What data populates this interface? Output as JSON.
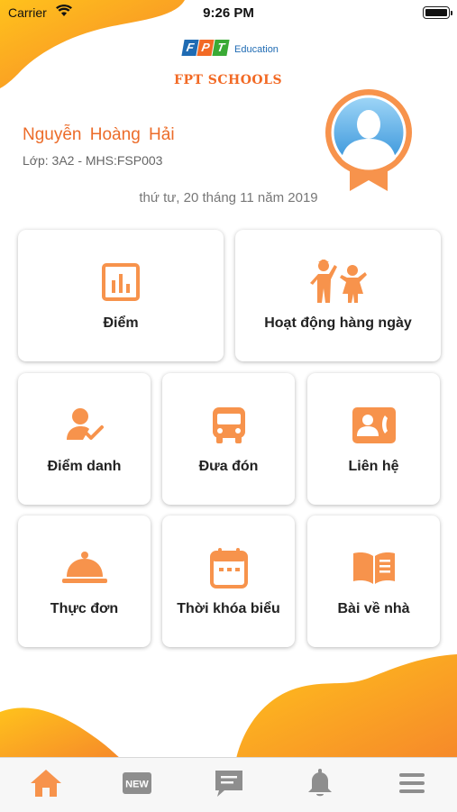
{
  "status_bar": {
    "carrier": "Carrier",
    "time": "9:26 PM"
  },
  "logo": {
    "letters": [
      "F",
      "P",
      "T"
    ],
    "letter_colors": [
      "#1f6bb3",
      "#f26a25",
      "#3aaa35"
    ],
    "education": "Education",
    "schools": "FPT SCHOOLS"
  },
  "student": {
    "name": "Nguyễn Hoàng Hải",
    "class_info": "Lớp: 3A2 - MHS:FSP003"
  },
  "date": "thứ tư, 20 tháng 11 năm 2019",
  "menu": [
    {
      "label": "Điểm",
      "icon": "chart-icon"
    },
    {
      "label": "Hoạt động hàng ngày",
      "icon": "kids-activity-icon"
    },
    {
      "label": "Điểm danh",
      "icon": "attendance-icon"
    },
    {
      "label": "Đưa đón",
      "icon": "bus-icon"
    },
    {
      "label": "Liên hệ",
      "icon": "contact-icon"
    },
    {
      "label": "Thực đơn",
      "icon": "food-cloche-icon"
    },
    {
      "label": "Thời khóa biểu",
      "icon": "calendar-icon"
    },
    {
      "label": "Bài về nhà",
      "icon": "homework-book-icon"
    }
  ],
  "tabbar": {
    "new_badge": "NEW",
    "tabs": [
      "home-icon",
      "news-icon",
      "message-icon",
      "bell-icon",
      "menu-icon"
    ]
  },
  "colors": {
    "accent": "#f7934c",
    "accent_dark": "#ec6c2a",
    "wave_yellow": "#ffc21c",
    "wave_orange": "#f6892a",
    "tab_inactive": "#8e8e8e"
  }
}
